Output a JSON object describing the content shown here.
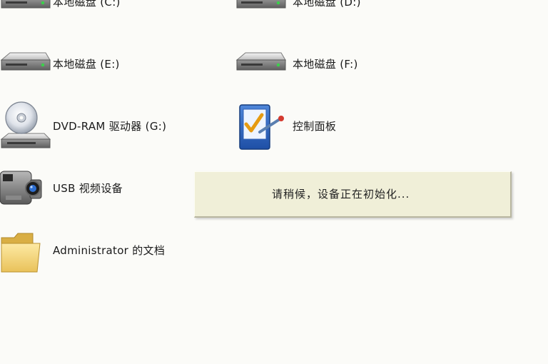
{
  "items": [
    {
      "label": "本地磁盘 (C:)",
      "icon": "hard-drive-icon"
    },
    {
      "label": "本地磁盘 (D:)",
      "icon": "hard-drive-icon"
    },
    {
      "label": "本地磁盘 (E:)",
      "icon": "hard-drive-icon"
    },
    {
      "label": "本地磁盘 (F:)",
      "icon": "hard-drive-icon"
    },
    {
      "label": "DVD-RAM 驱动器 (G:)",
      "icon": "dvd-drive-icon"
    },
    {
      "label": "控制面板",
      "icon": "control-panel-icon"
    },
    {
      "label": "USB 视频设备",
      "icon": "video-camera-icon"
    },
    {
      "label": "Administrator 的文档",
      "icon": "folder-icon"
    }
  ],
  "tooltip": {
    "message": "请稍候，设备正在初始化..."
  }
}
